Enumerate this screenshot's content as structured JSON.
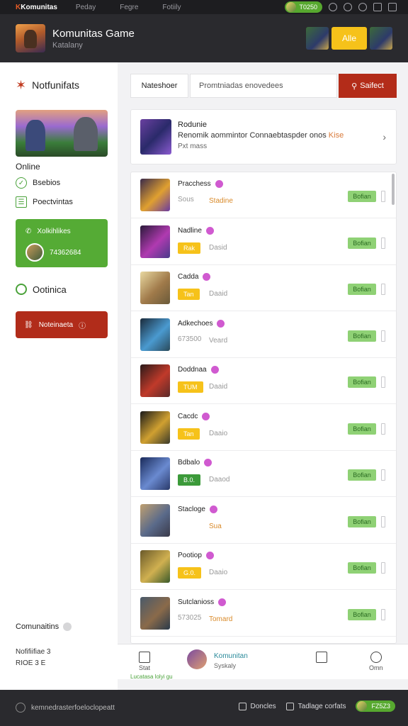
{
  "topbar": {
    "brand": "Komunitas",
    "nav": [
      "Peday",
      "Fegre",
      "Fotiily"
    ],
    "coins": "T0250"
  },
  "header": {
    "title": "Komunitas Game",
    "subtitle": "Katalany",
    "action_label": "Alle"
  },
  "sidebar": {
    "title": "Notfunifats",
    "online_label": "Online",
    "items": [
      {
        "label": "Bsebios"
      },
      {
        "label": "Poectvintas"
      }
    ],
    "green_card": {
      "line1": "Xolkihlikes",
      "line2": "74362684"
    },
    "option_label": "Ootinica",
    "red_button": "Noteinaeta",
    "community_label": "Comunaitins",
    "footer_lines": [
      "Nofifiifiae 3",
      "RIOE 3 E"
    ]
  },
  "search": {
    "tab_label": "Nateshoer",
    "placeholder": "Promtniadas enovedees",
    "select_label": "Saifect"
  },
  "featured": {
    "title": "Rodunie",
    "desc": "Renomik aommintor Connaebtaspder onos",
    "desc_accent": "Kise",
    "meta": "Pxt mass"
  },
  "list": [
    {
      "name": "Pracchess",
      "sub1": "Sous",
      "sub2": "Stadine",
      "sub2_accent": true,
      "badge": "",
      "badge_color": "",
      "follow": "Bofian",
      "thumb": [
        "#3a2a4a",
        "#e0a030",
        "#6a3aa0"
      ]
    },
    {
      "name": "Nadline",
      "sub1": "",
      "sub2": "Dasid",
      "sub2_accent": false,
      "badge": "Rak",
      "badge_color": "y",
      "follow": "Bofian",
      "thumb": [
        "#2a1a3a",
        "#b03ab0",
        "#4a3a8a"
      ]
    },
    {
      "name": "Cadda",
      "sub1": "",
      "sub2": "Daaid",
      "sub2_accent": false,
      "badge": "Tan",
      "badge_color": "y",
      "follow": "Bofian",
      "thumb": [
        "#e8d8a0",
        "#a07a4a",
        "#6a5a3a"
      ]
    },
    {
      "name": "Adkechoes",
      "sub1": "673500",
      "sub2": "Veard",
      "sub2_accent": false,
      "badge": "",
      "badge_color": "",
      "follow": "Bofian",
      "thumb": [
        "#1a2a3a",
        "#4a9ad0",
        "#2a4a5a"
      ]
    },
    {
      "name": "Doddnaa",
      "sub1": "",
      "sub2": "Daaid",
      "sub2_accent": false,
      "badge": "TUM",
      "badge_color": "y",
      "follow": "Bofian",
      "thumb": [
        "#2a1a1a",
        "#c03a2a",
        "#5a2a2a"
      ]
    },
    {
      "name": "Cacdc",
      "sub1": "",
      "sub2": "Daaio",
      "sub2_accent": false,
      "badge": "Tan",
      "badge_color": "y",
      "follow": "Bofian",
      "thumb": [
        "#1a1a1a",
        "#d0a030",
        "#3a3a2a"
      ]
    },
    {
      "name": "Bdbalo",
      "sub1": "",
      "sub2": "Daaod",
      "sub2_accent": false,
      "badge": "B.0.",
      "badge_color": "g",
      "follow": "Bofian",
      "thumb": [
        "#1a2a5a",
        "#6a8ad0",
        "#2a3a6a"
      ]
    },
    {
      "name": "Stacloge",
      "sub1": "",
      "sub2": "Sua",
      "sub2_accent": true,
      "badge": "",
      "badge_color": "",
      "follow": "Bofian",
      "thumb": [
        "#c0a070",
        "#5a6a8a",
        "#3a3a4a"
      ]
    },
    {
      "name": "Pootiop",
      "sub1": "",
      "sub2": "Daaio",
      "sub2_accent": false,
      "badge": "G.0.",
      "badge_color": "y",
      "follow": "Bofian",
      "thumb": [
        "#6a5a2a",
        "#d0b050",
        "#3a5a2a"
      ]
    },
    {
      "name": "Sutclanioss",
      "sub1": "573025",
      "sub2": "Tomard",
      "sub2_accent": true,
      "badge": "",
      "badge_color": "",
      "follow": "Bofian",
      "thumb": [
        "#4a5a6a",
        "#8a6a4a",
        "#2a3a4a"
      ]
    }
  ],
  "bottomnav": {
    "home_label": "Stat",
    "center_title": "Komunitan",
    "center_sub": "Syskaly",
    "right_label": "Omn"
  },
  "greenline": "Lucatasa lolyi gu",
  "footer": {
    "left": "kemnedrasterfoeloclopeatt",
    "right1": "Doncles",
    "right2": "Tadlage corfats",
    "coins": "FZ5Z3"
  }
}
